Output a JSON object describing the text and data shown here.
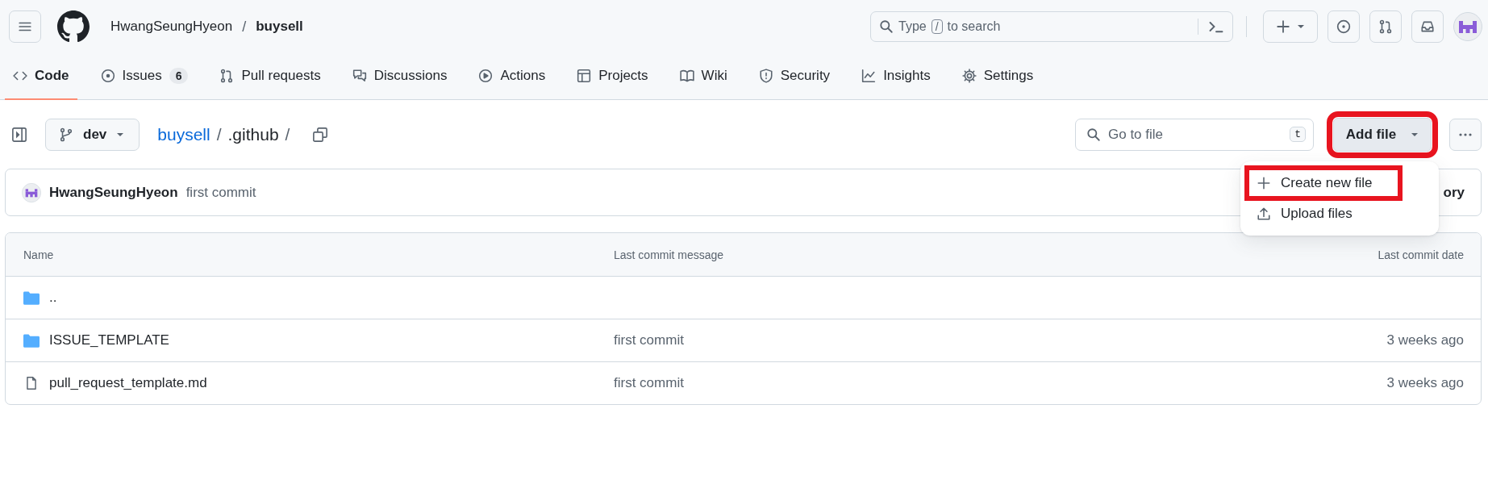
{
  "header": {
    "owner": "HwangSeungHyeon",
    "separator": "/",
    "repo": "buysell",
    "search": {
      "prefix": "Type",
      "key": "/",
      "suffix": "to search"
    }
  },
  "tabs": [
    {
      "label": "Code",
      "selected": true
    },
    {
      "label": "Issues",
      "count": "6",
      "selected": false
    },
    {
      "label": "Pull requests",
      "selected": false
    },
    {
      "label": "Discussions",
      "selected": false
    },
    {
      "label": "Actions",
      "selected": false
    },
    {
      "label": "Projects",
      "selected": false
    },
    {
      "label": "Wiki",
      "selected": false
    },
    {
      "label": "Security",
      "selected": false
    },
    {
      "label": "Insights",
      "selected": false
    },
    {
      "label": "Settings",
      "selected": false
    }
  ],
  "toolbar": {
    "branch": "dev",
    "path": [
      {
        "text": "buysell",
        "kind": "link"
      },
      {
        "text": "/",
        "kind": "sep"
      },
      {
        "text": ".github",
        "kind": "current"
      },
      {
        "text": "/",
        "kind": "sep"
      }
    ],
    "go_to_file": {
      "placeholder": "Go to file",
      "shortcut": "t"
    },
    "add_file": {
      "label": "Add file",
      "highlighted": true
    }
  },
  "menu": [
    {
      "label": "Create new file",
      "highlighted": true
    },
    {
      "label": "Upload files",
      "highlighted": false
    }
  ],
  "commit": {
    "author": "HwangSeungHyeon",
    "message": "first commit",
    "history": "ory"
  },
  "table": {
    "columns": [
      "Name",
      "Last commit message",
      "Last commit date"
    ],
    "rows": [
      {
        "kind": "folder",
        "name": ".."
      },
      {
        "kind": "folder",
        "name": "ISSUE_TEMPLATE",
        "message": "first commit",
        "date": "3 weeks ago"
      },
      {
        "kind": "file",
        "name": "pull_request_template.md",
        "message": "first commit",
        "date": "3 weeks ago"
      }
    ]
  }
}
